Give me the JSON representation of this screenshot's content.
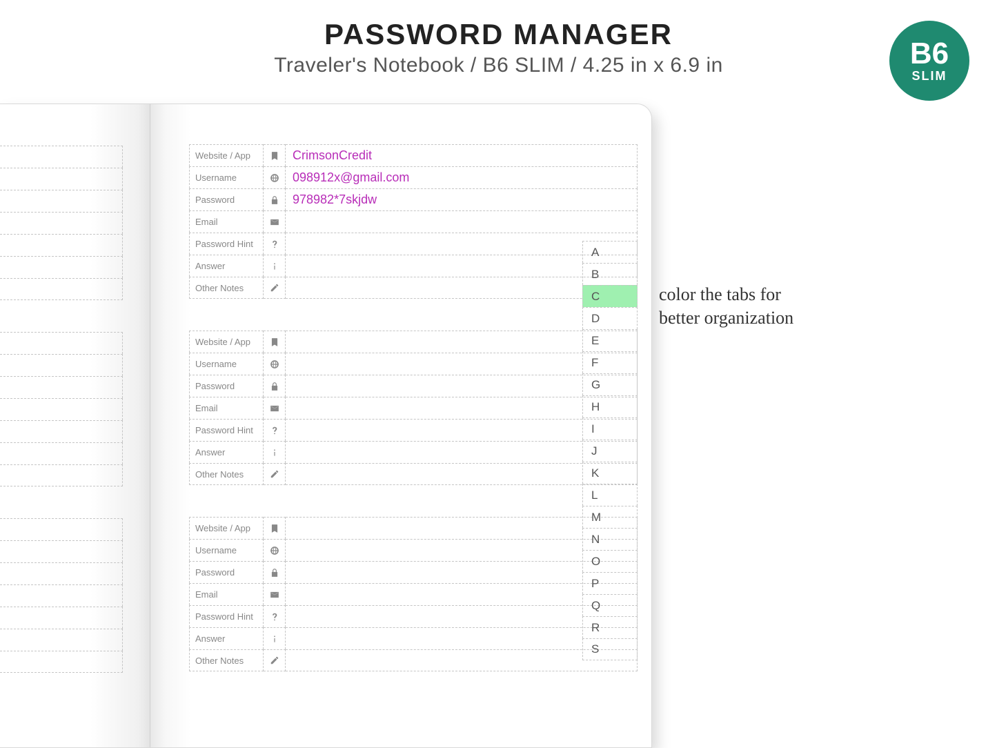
{
  "header": {
    "title": "PASSWORD MANAGER",
    "subtitle": "Traveler's Notebook / B6 SLIM / 4.25 in x 6.9 in"
  },
  "badge": {
    "top": "B6",
    "bottom": "SLIM"
  },
  "annotation": {
    "line1": "color the tabs for",
    "line2": "better organization"
  },
  "fields": [
    {
      "label": "Website / App",
      "icon": "bookmark-icon"
    },
    {
      "label": "Username",
      "icon": "globe-icon"
    },
    {
      "label": "Password",
      "icon": "lock-icon"
    },
    {
      "label": "Email",
      "icon": "envelope-icon"
    },
    {
      "label": "Password Hint",
      "icon": "question-icon"
    },
    {
      "label": "Answer",
      "icon": "info-icon"
    },
    {
      "label": "Other Notes",
      "icon": "pencil-icon"
    }
  ],
  "entries": [
    {
      "website": "CrimsonCredit",
      "username": "098912x@gmail.com",
      "password": "978982*7skjdw",
      "email": "",
      "hint": "",
      "answer": "",
      "notes": ""
    },
    {
      "website": "",
      "username": "",
      "password": "",
      "email": "",
      "hint": "",
      "answer": "",
      "notes": ""
    },
    {
      "website": "",
      "username": "",
      "password": "",
      "email": "",
      "hint": "",
      "answer": "",
      "notes": ""
    }
  ],
  "tabs": {
    "letters": [
      "A",
      "B",
      "C",
      "D",
      "E",
      "F",
      "G",
      "H",
      "I",
      "J",
      "K",
      "L",
      "M",
      "N",
      "O",
      "P",
      "Q",
      "R",
      "S"
    ],
    "active": "C"
  }
}
